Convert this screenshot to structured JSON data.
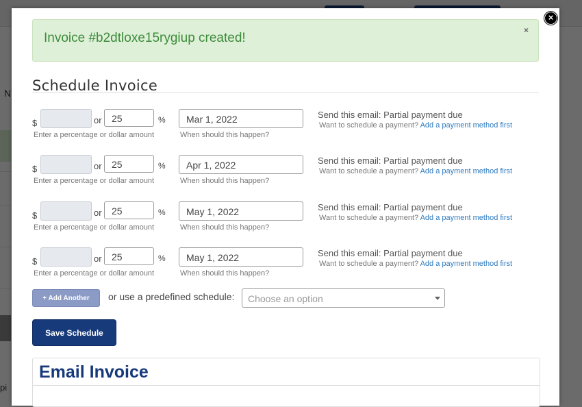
{
  "alert": {
    "message": "Invoice #b2dtloxe15rygiup created!",
    "close": "×"
  },
  "modal": {
    "close": "×"
  },
  "schedule": {
    "title": "Schedule Invoice",
    "currency_symbol": "$",
    "or_label": "or",
    "percent_symbol": "%",
    "amount_hint": "Enter a percentage or dollar amount",
    "date_hint": "When should this happen?",
    "rows": [
      {
        "amount": "",
        "percent": "25",
        "date": "Mar 1, 2022",
        "email": "Send this email: Partial payment due",
        "note": "Want to schedule a payment?",
        "link": "Add a payment method first"
      },
      {
        "amount": "",
        "percent": "25",
        "date": "Apr 1, 2022",
        "email": "Send this email: Partial payment due",
        "note": "Want to schedule a payment?",
        "link": "Add a payment method first"
      },
      {
        "amount": "",
        "percent": "25",
        "date": "May 1, 2022",
        "email": "Send this email: Partial payment due",
        "note": "Want to schedule a payment?",
        "link": "Add a payment method first"
      },
      {
        "amount": "",
        "percent": "25",
        "date": "May 1, 2022",
        "email": "Send this email: Partial payment due",
        "note": "Want to schedule a payment?",
        "link": "Add a payment method first"
      }
    ],
    "add_another": "+ Add Another",
    "predefined_label": "or use a predefined schedule:",
    "predefined_placeholder": "Choose an option",
    "save_button": "Save Schedule"
  },
  "email_invoice": {
    "title": "Email Invoice"
  },
  "background": {
    "letter_n": "N",
    "letter_cropped": "pi"
  },
  "colors": {
    "alert_bg": "#dff0d8",
    "alert_text": "#3c8b3a",
    "primary": "#163a7a",
    "add_button": "#8b9bc6",
    "link": "#2f7bbf"
  },
  "icons": {
    "close": "close-icon",
    "dropdown": "chevron-down-icon"
  }
}
